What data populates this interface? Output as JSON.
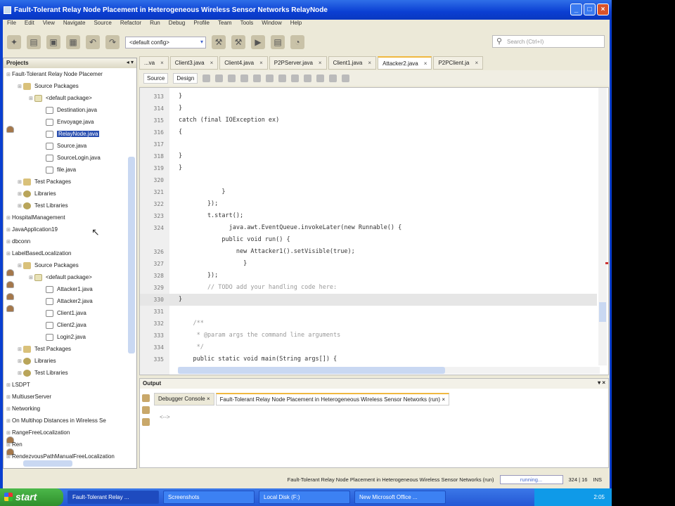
{
  "window": {
    "title": "Fault-Tolerant Relay Node Placement in Heterogeneous Wireless Sensor Networks RelayNode"
  },
  "menu": [
    "File",
    "Edit",
    "View",
    "Navigate",
    "Source",
    "Refactor",
    "Run",
    "Debug",
    "Profile",
    "Team",
    "Tools",
    "Window",
    "Help"
  ],
  "toolbar": {
    "config": "<default config>",
    "search_placeholder": "Search (Ctrl+I)"
  },
  "projects": {
    "title": "Projects",
    "nodes": [
      {
        "label": "Fault-Tolerant Relay Node Placemer",
        "type": "proj",
        "level": 0
      },
      {
        "label": "Source Packages",
        "type": "folder",
        "level": 1
      },
      {
        "label": "<default package>",
        "type": "pkg",
        "level": 2
      },
      {
        "label": "Destination.java",
        "type": "file",
        "level": 3
      },
      {
        "label": "Envoyage.java",
        "type": "file",
        "level": 3
      },
      {
        "label": "RelayNode.java",
        "type": "file",
        "level": 3,
        "selected": true
      },
      {
        "label": "Source.java",
        "type": "file",
        "level": 3
      },
      {
        "label": "SourceLogin.java",
        "type": "file",
        "level": 3
      },
      {
        "label": "file.java",
        "type": "file",
        "level": 3
      },
      {
        "label": "Test Packages",
        "type": "folder",
        "level": 1
      },
      {
        "label": "Libraries",
        "type": "lib",
        "level": 1
      },
      {
        "label": "Test Libraries",
        "type": "lib",
        "level": 1
      },
      {
        "label": "HospitalManagement",
        "type": "proj",
        "level": 0
      },
      {
        "label": "JavaApplication19",
        "type": "proj",
        "level": 0
      },
      {
        "label": "dbconn",
        "type": "proj",
        "level": 0
      },
      {
        "label": "LabelBasedLocalization",
        "type": "proj",
        "level": 0
      },
      {
        "label": "Source Packages",
        "type": "folder",
        "level": 1
      },
      {
        "label": "<default package>",
        "type": "pkg",
        "level": 2
      },
      {
        "label": "Attacker1.java",
        "type": "file",
        "level": 3
      },
      {
        "label": "Attacker2.java",
        "type": "file",
        "level": 3
      },
      {
        "label": "Client1.java",
        "type": "file",
        "level": 3
      },
      {
        "label": "Client2.java",
        "type": "file",
        "level": 3
      },
      {
        "label": "Login2.java",
        "type": "file",
        "level": 3
      },
      {
        "label": "Test Packages",
        "type": "folder",
        "level": 1
      },
      {
        "label": "Libraries",
        "type": "lib",
        "level": 1
      },
      {
        "label": "Test Libraries",
        "type": "lib",
        "level": 1
      },
      {
        "label": "LSDPT",
        "type": "proj",
        "level": 0
      },
      {
        "label": "MultiuserServer",
        "type": "proj",
        "level": 0
      },
      {
        "label": "Networking",
        "type": "proj",
        "level": 0
      },
      {
        "label": "On Multihop Distances in Wireless Se",
        "type": "proj",
        "level": 0
      },
      {
        "label": "RangeFreeLocalization",
        "type": "proj",
        "level": 0
      },
      {
        "label": "Ren",
        "type": "proj",
        "level": 0
      },
      {
        "label": "RendezvousPathManualFreeLocalization",
        "type": "proj",
        "level": 0
      }
    ]
  },
  "editor": {
    "tabs": [
      {
        "label": "...va"
      },
      {
        "label": "Client3.java"
      },
      {
        "label": "Client4.java"
      },
      {
        "label": "P2PServer.java"
      },
      {
        "label": "Client1.java"
      },
      {
        "label": "Attacker2.java",
        "active": true
      },
      {
        "label": "P2PClient.ja"
      }
    ],
    "source_label": "Source",
    "design_label": "Design",
    "lines": [
      {
        "n": "313",
        "code": "}"
      },
      {
        "n": "314",
        "code": "}"
      },
      {
        "n": "315",
        "code": "catch (final IOException ex)"
      },
      {
        "n": "316",
        "code": "{"
      },
      {
        "n": "317",
        "code": ""
      },
      {
        "n": "318",
        "code": "}"
      },
      {
        "n": "319",
        "code": "}"
      },
      {
        "n": "320",
        "code": ""
      },
      {
        "n": "321",
        "code": "            }"
      },
      {
        "n": "322",
        "code": "        });"
      },
      {
        "n": "323",
        "code": "        t.start();"
      },
      {
        "n": "324",
        "code": "              java.awt.EventQueue.invokeLater(new Runnable() {"
      },
      {
        "n": "",
        "code": "            public void run() {"
      },
      {
        "n": "326",
        "code": "                new Attacker1().setVisible(true);"
      },
      {
        "n": "327",
        "code": "                  }"
      },
      {
        "n": "328",
        "code": "        });"
      },
      {
        "n": "329",
        "code": "        // TODO add your handling code here:",
        "comment": true
      },
      {
        "n": "330",
        "code": "}",
        "current": true
      },
      {
        "n": "331",
        "code": ""
      },
      {
        "n": "332",
        "code": "    /**",
        "comment": true
      },
      {
        "n": "333",
        "code": "     * @param args the command line arguments",
        "comment": true
      },
      {
        "n": "334",
        "code": "     */",
        "comment": true
      },
      {
        "n": "335",
        "code": "    public static void main(String args[]) {"
      }
    ]
  },
  "output": {
    "title": "Output",
    "tabs": [
      {
        "label": "Debugger Console"
      },
      {
        "label": "Fault-Tolerant Relay Node Placement in Heterogeneous Wireless Sensor Networks (run)",
        "active": true
      }
    ],
    "text": "<-->"
  },
  "status": {
    "task": "Fault-Tolerant Relay Node Placement in Heterogeneous Wireless Sensor Networks (run)",
    "progress": "running...",
    "position": "324 | 16",
    "mode": "INS"
  },
  "taskbar": {
    "start": "start",
    "items": [
      "Fault-Tolerant Relay ...",
      "Screenshots",
      "Local Disk (F:)",
      "New Microsoft Office ..."
    ],
    "clock": "2:05"
  }
}
